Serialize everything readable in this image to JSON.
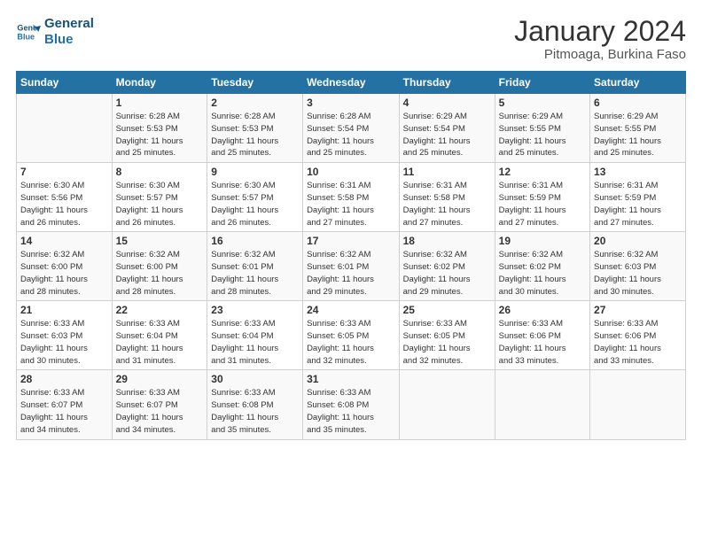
{
  "logo": {
    "line1": "General",
    "line2": "Blue"
  },
  "title": "January 2024",
  "subtitle": "Pitmoaga, Burkina Faso",
  "headers": [
    "Sunday",
    "Monday",
    "Tuesday",
    "Wednesday",
    "Thursday",
    "Friday",
    "Saturday"
  ],
  "weeks": [
    [
      {
        "day": "",
        "info": ""
      },
      {
        "day": "1",
        "info": "Sunrise: 6:28 AM\nSunset: 5:53 PM\nDaylight: 11 hours\nand 25 minutes."
      },
      {
        "day": "2",
        "info": "Sunrise: 6:28 AM\nSunset: 5:53 PM\nDaylight: 11 hours\nand 25 minutes."
      },
      {
        "day": "3",
        "info": "Sunrise: 6:28 AM\nSunset: 5:54 PM\nDaylight: 11 hours\nand 25 minutes."
      },
      {
        "day": "4",
        "info": "Sunrise: 6:29 AM\nSunset: 5:54 PM\nDaylight: 11 hours\nand 25 minutes."
      },
      {
        "day": "5",
        "info": "Sunrise: 6:29 AM\nSunset: 5:55 PM\nDaylight: 11 hours\nand 25 minutes."
      },
      {
        "day": "6",
        "info": "Sunrise: 6:29 AM\nSunset: 5:55 PM\nDaylight: 11 hours\nand 25 minutes."
      }
    ],
    [
      {
        "day": "7",
        "info": "Sunrise: 6:30 AM\nSunset: 5:56 PM\nDaylight: 11 hours\nand 26 minutes."
      },
      {
        "day": "8",
        "info": "Sunrise: 6:30 AM\nSunset: 5:57 PM\nDaylight: 11 hours\nand 26 minutes."
      },
      {
        "day": "9",
        "info": "Sunrise: 6:30 AM\nSunset: 5:57 PM\nDaylight: 11 hours\nand 26 minutes."
      },
      {
        "day": "10",
        "info": "Sunrise: 6:31 AM\nSunset: 5:58 PM\nDaylight: 11 hours\nand 27 minutes."
      },
      {
        "day": "11",
        "info": "Sunrise: 6:31 AM\nSunset: 5:58 PM\nDaylight: 11 hours\nand 27 minutes."
      },
      {
        "day": "12",
        "info": "Sunrise: 6:31 AM\nSunset: 5:59 PM\nDaylight: 11 hours\nand 27 minutes."
      },
      {
        "day": "13",
        "info": "Sunrise: 6:31 AM\nSunset: 5:59 PM\nDaylight: 11 hours\nand 27 minutes."
      }
    ],
    [
      {
        "day": "14",
        "info": "Sunrise: 6:32 AM\nSunset: 6:00 PM\nDaylight: 11 hours\nand 28 minutes."
      },
      {
        "day": "15",
        "info": "Sunrise: 6:32 AM\nSunset: 6:00 PM\nDaylight: 11 hours\nand 28 minutes."
      },
      {
        "day": "16",
        "info": "Sunrise: 6:32 AM\nSunset: 6:01 PM\nDaylight: 11 hours\nand 28 minutes."
      },
      {
        "day": "17",
        "info": "Sunrise: 6:32 AM\nSunset: 6:01 PM\nDaylight: 11 hours\nand 29 minutes."
      },
      {
        "day": "18",
        "info": "Sunrise: 6:32 AM\nSunset: 6:02 PM\nDaylight: 11 hours\nand 29 minutes."
      },
      {
        "day": "19",
        "info": "Sunrise: 6:32 AM\nSunset: 6:02 PM\nDaylight: 11 hours\nand 30 minutes."
      },
      {
        "day": "20",
        "info": "Sunrise: 6:32 AM\nSunset: 6:03 PM\nDaylight: 11 hours\nand 30 minutes."
      }
    ],
    [
      {
        "day": "21",
        "info": "Sunrise: 6:33 AM\nSunset: 6:03 PM\nDaylight: 11 hours\nand 30 minutes."
      },
      {
        "day": "22",
        "info": "Sunrise: 6:33 AM\nSunset: 6:04 PM\nDaylight: 11 hours\nand 31 minutes."
      },
      {
        "day": "23",
        "info": "Sunrise: 6:33 AM\nSunset: 6:04 PM\nDaylight: 11 hours\nand 31 minutes."
      },
      {
        "day": "24",
        "info": "Sunrise: 6:33 AM\nSunset: 6:05 PM\nDaylight: 11 hours\nand 32 minutes."
      },
      {
        "day": "25",
        "info": "Sunrise: 6:33 AM\nSunset: 6:05 PM\nDaylight: 11 hours\nand 32 minutes."
      },
      {
        "day": "26",
        "info": "Sunrise: 6:33 AM\nSunset: 6:06 PM\nDaylight: 11 hours\nand 33 minutes."
      },
      {
        "day": "27",
        "info": "Sunrise: 6:33 AM\nSunset: 6:06 PM\nDaylight: 11 hours\nand 33 minutes."
      }
    ],
    [
      {
        "day": "28",
        "info": "Sunrise: 6:33 AM\nSunset: 6:07 PM\nDaylight: 11 hours\nand 34 minutes."
      },
      {
        "day": "29",
        "info": "Sunrise: 6:33 AM\nSunset: 6:07 PM\nDaylight: 11 hours\nand 34 minutes."
      },
      {
        "day": "30",
        "info": "Sunrise: 6:33 AM\nSunset: 6:08 PM\nDaylight: 11 hours\nand 35 minutes."
      },
      {
        "day": "31",
        "info": "Sunrise: 6:33 AM\nSunset: 6:08 PM\nDaylight: 11 hours\nand 35 minutes."
      },
      {
        "day": "",
        "info": ""
      },
      {
        "day": "",
        "info": ""
      },
      {
        "day": "",
        "info": ""
      }
    ]
  ]
}
